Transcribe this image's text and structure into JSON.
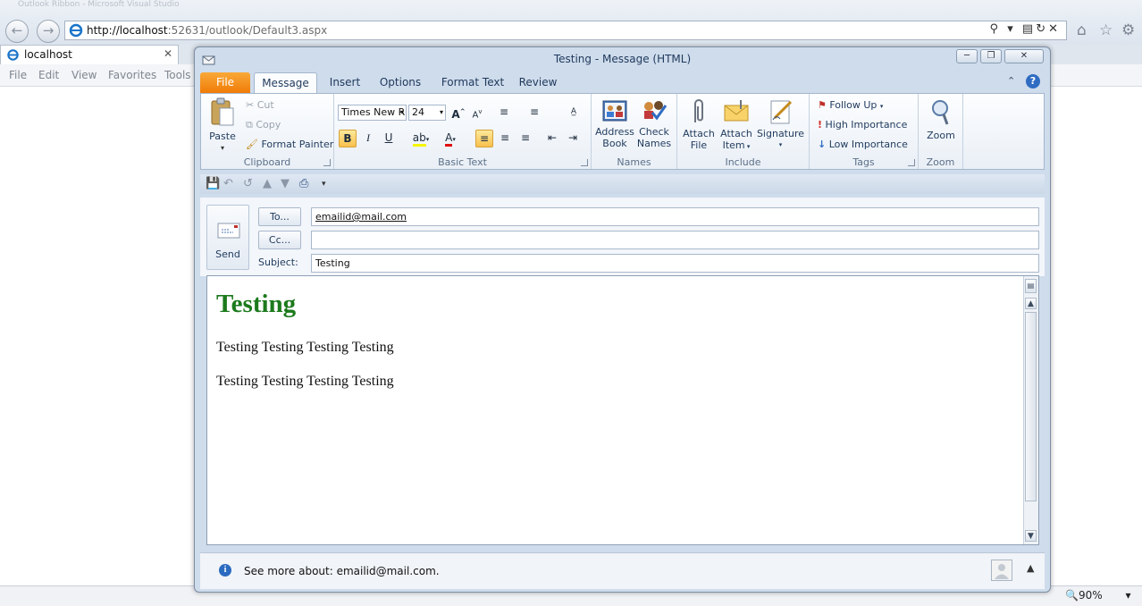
{
  "browser": {
    "blurred_title": "Outlook Ribbon - Microsoft Visual Studio",
    "url_host": "http://localhost",
    "url_rest": ":52631/outlook/Default3.aspx",
    "tab_title": "localhost",
    "menu": [
      "File",
      "Edit",
      "View",
      "Favorites",
      "Tools"
    ],
    "zoom": "90%"
  },
  "window": {
    "title": "Testing  -  Message (HTML)"
  },
  "ribbon": {
    "tabs": [
      "File",
      "Message",
      "Insert",
      "Options",
      "Format Text",
      "Review"
    ],
    "clipboard": {
      "paste": "Paste",
      "cut": "Cut",
      "copy": "Copy",
      "format_painter": "Format Painter",
      "label": "Clipboard"
    },
    "basic_text": {
      "font": "Times New R",
      "size": "24",
      "bold": "B",
      "italic": "I",
      "underline": "U",
      "label": "Basic Text"
    },
    "names": {
      "address_book_1": "Address",
      "address_book_2": "Book",
      "check_names_1": "Check",
      "check_names_2": "Names",
      "label": "Names"
    },
    "include": {
      "attach_file_1": "Attach",
      "attach_file_2": "File",
      "attach_item_1": "Attach",
      "attach_item_2": "Item",
      "signature": "Signature",
      "label": "Include"
    },
    "tags": {
      "follow_up": "Follow Up",
      "high": "High Importance",
      "low": "Low Importance",
      "label": "Tags"
    },
    "zoom": {
      "zoom": "Zoom",
      "label": "Zoom"
    }
  },
  "header": {
    "send": "Send",
    "to_button": "To...",
    "cc_button": "Cc...",
    "subject_label": "Subject:",
    "to_value": "emailid@mail.com",
    "cc_value": "",
    "subject_value": "Testing"
  },
  "body": {
    "heading": "Testing",
    "para1": "Testing Testing Testing Testing",
    "para2": "Testing Testing Testing Testing"
  },
  "people_pane": {
    "text": "See more about: emailid@mail.com."
  },
  "colors": {
    "accent_file": "#f07b06",
    "heading_green": "#1c7a1c",
    "ribbon_blue": "#1e395b"
  }
}
